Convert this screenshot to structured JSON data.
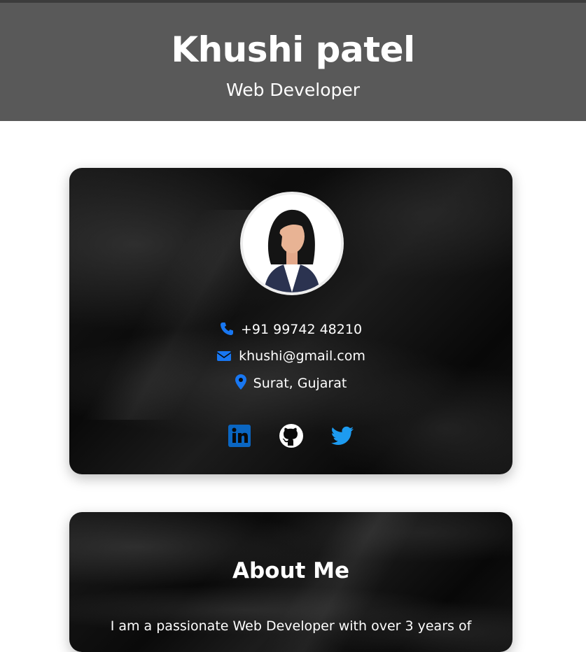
{
  "header": {
    "name": "Khushi patel",
    "title": "Web Developer"
  },
  "profile": {
    "avatar_alt": "avatar",
    "contacts": [
      {
        "icon": "phone-icon",
        "text": "+91 99742 48210"
      },
      {
        "icon": "envelope-icon",
        "text": "khushi@gmail.com"
      },
      {
        "icon": "map-marker-icon",
        "text": "Surat, Gujarat"
      }
    ],
    "socials": [
      {
        "icon": "linkedin-icon",
        "color": "#0a66c2"
      },
      {
        "icon": "github-icon",
        "color": "#ffffff"
      },
      {
        "icon": "twitter-icon",
        "color": "#1d9bf0"
      }
    ]
  },
  "about": {
    "title": "About Me",
    "text": "I am a passionate Web Developer with over 3 years of"
  },
  "colors": {
    "header_bg": "#595959",
    "accent_blue": "#1877f2"
  }
}
